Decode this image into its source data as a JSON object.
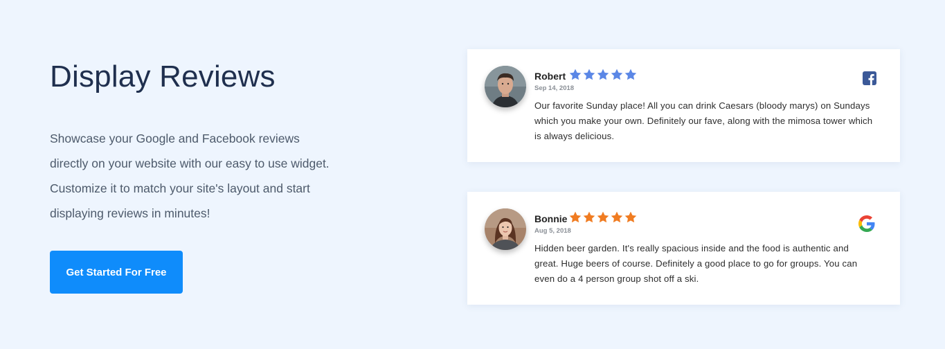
{
  "hero": {
    "title": "Display Reviews",
    "description": "Showcase your Google and Facebook reviews directly on your website with our easy to use widget. Customize it to match your site's layout and start displaying reviews in minutes!",
    "cta_label": "Get Started For Free"
  },
  "reviews": [
    {
      "name": "Robert",
      "date": "Sep 14, 2018",
      "rating": 5,
      "star_color": "#5b87e6",
      "source_icon": "facebook-icon",
      "text": "Our favorite Sunday place! All you can drink Caesars (bloody marys) on Sundays which you make your own. Definitely our fave, along with the mimosa tower which is always delicious."
    },
    {
      "name": "Bonnie",
      "date": "Aug 5, 2018",
      "rating": 5,
      "star_color": "#f07c22",
      "source_icon": "google-icon",
      "text": "Hidden beer garden. It's really spacious inside and the food is authentic and great. Huge beers of course. Definitely a good place to go for groups. You can even do a 4 person group shot off a ski."
    }
  ],
  "colors": {
    "background": "#eef5fe",
    "title": "#1f2f4e",
    "cta": "#0f8cfb",
    "facebook": "#3b5998"
  }
}
